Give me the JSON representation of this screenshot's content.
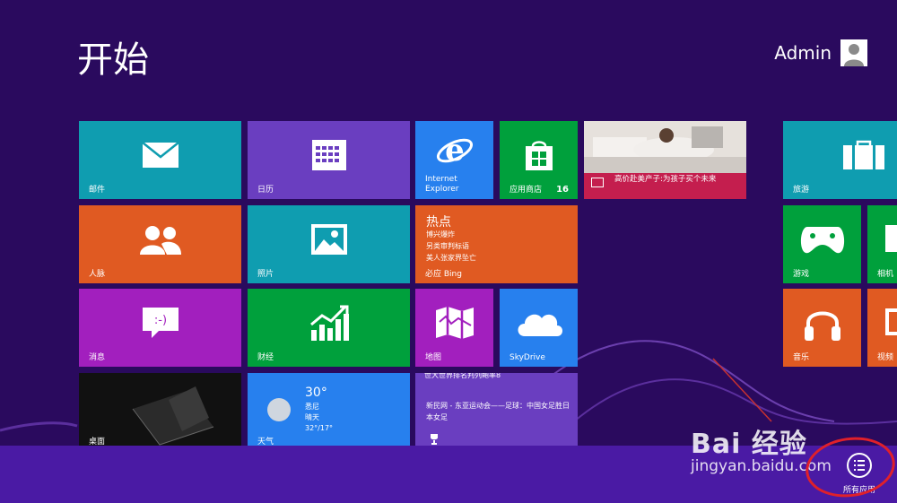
{
  "start": {
    "title": "开始",
    "user": {
      "name": "Admin"
    }
  },
  "tiles": {
    "mail": {
      "label": "邮件",
      "color": "#0f9db0"
    },
    "calendar": {
      "label": "日历",
      "color": "#6a3ec0"
    },
    "ie": {
      "label": "Internet Explorer",
      "color": "#2780ee"
    },
    "store": {
      "label": "应用商店",
      "badge": "16",
      "color": "#00a03c"
    },
    "news_photo": {
      "caption": "高价赴美产子:为孩子买个未来",
      "color": "#c41e4e"
    },
    "travel": {
      "label": "旅游",
      "color": "#0f9db0"
    },
    "people": {
      "label": "人脉",
      "color": "#e05a22"
    },
    "photos": {
      "label": "照片",
      "color": "#0f9db0"
    },
    "hot": {
      "title": "热点",
      "lines": [
        "博兴爆炸",
        "另类审判标语",
        "美人张家界坠亡"
      ],
      "label": "必应 Bing",
      "color": "#e05a22"
    },
    "games": {
      "label": "游戏",
      "color": "#00a03c"
    },
    "camera": {
      "label": "相机",
      "color": "#00a03c"
    },
    "messaging": {
      "label": "消息",
      "color": "#a21fbe"
    },
    "finance": {
      "label": "财经",
      "color": "#00a03c"
    },
    "maps": {
      "label": "地图",
      "color": "#a21fbe"
    },
    "skydrive": {
      "label": "SkyDrive",
      "color": "#2780ee"
    },
    "music": {
      "label": "音乐",
      "color": "#e05a22"
    },
    "video": {
      "label": "视频",
      "color": "#e05a22"
    },
    "desktop": {
      "label": "桌面",
      "color": "#111111"
    },
    "weather": {
      "temp": "30°",
      "lines": [
        "悉尼",
        "晴天",
        "32°/17°"
      ],
      "label": "天气",
      "color": "#2780ee"
    },
    "sports": {
      "top": "世大世界排名判列鲍率8",
      "lines": [
        "新民网 - 东亚运动会——足球：中国女足胜日本女足"
      ],
      "color": "#6a3ec0"
    }
  },
  "charms": {
    "all_apps": "所有应用"
  },
  "watermark": {
    "top": "Bai 经验",
    "bottom": "jingyan.baidu.com"
  },
  "icons": [
    "mail-icon",
    "calendar-icon",
    "ie-icon",
    "store-icon",
    "suitcase-icon",
    "people-icon",
    "photo-icon",
    "gamepad-icon",
    "camera-icon",
    "chat-icon",
    "chart-icon",
    "map-icon",
    "cloud-icon",
    "headphones-icon",
    "video-icon",
    "moon-icon",
    "trophy-icon",
    "all-apps-icon",
    "user-avatar-icon"
  ]
}
